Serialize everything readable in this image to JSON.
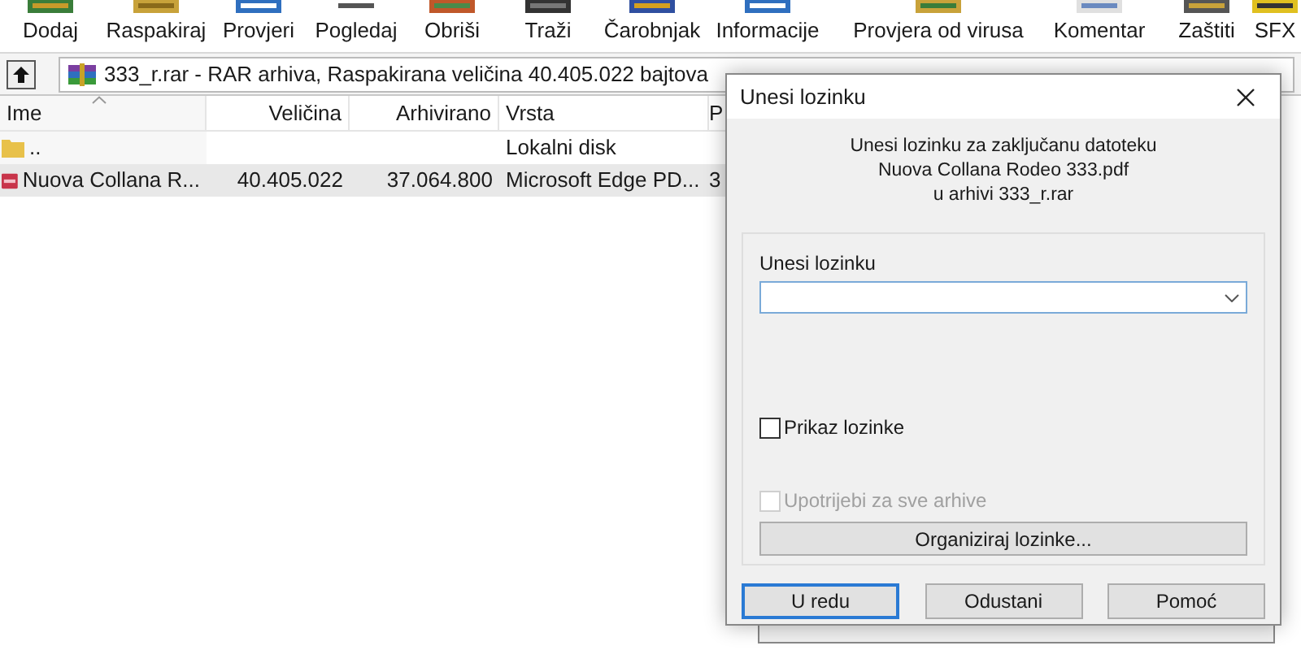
{
  "toolbar": [
    {
      "label": "Dodaj"
    },
    {
      "label": "Raspakiraj"
    },
    {
      "label": "Provjeri"
    },
    {
      "label": "Pogledaj"
    },
    {
      "label": "Obriši"
    },
    {
      "label": "Traži"
    },
    {
      "label": "Čarobnjak"
    },
    {
      "label": "Informacije"
    },
    {
      "label": "Provjera od virusa"
    },
    {
      "label": "Komentar"
    },
    {
      "label": "Zaštiti"
    },
    {
      "label": "SFX"
    }
  ],
  "address_bar": {
    "text": "333_r.rar - RAR arhiva, Raspakirana veličina 40.405.022 bajtova"
  },
  "file_list": {
    "columns": [
      {
        "label": "Ime",
        "sorted": true
      },
      {
        "label": "Veličina",
        "sorted": false
      },
      {
        "label": "Arhivirano",
        "sorted": false
      },
      {
        "label": "Vrsta",
        "sorted": false
      },
      {
        "label": "P"
      }
    ],
    "rows": [
      {
        "kind": "folder",
        "selected": false,
        "cells": [
          "..",
          "",
          "",
          "Lokalni disk",
          ""
        ]
      },
      {
        "kind": "pdf",
        "selected": true,
        "cells": [
          "Nuova Collana R...",
          "40.405.022",
          "37.064.800",
          "Microsoft Edge PD...",
          "3"
        ]
      }
    ]
  },
  "dialog": {
    "title": "Unesi lozinku",
    "message": [
      "Unesi lozinku za zaključanu datoteku",
      "Nuova Collana Rodeo 333.pdf",
      "u arhivi 333_r.rar"
    ],
    "password_label": "Unesi lozinku",
    "checkboxes": [
      {
        "label": "Prikaz lozinke",
        "checked": false,
        "disabled": false
      },
      {
        "label": "Upotrijebi za sve arhive",
        "checked": false,
        "disabled": true
      }
    ],
    "organize_button": "Organiziraj lozinke...",
    "buttons": [
      {
        "label": "U redu",
        "default": true
      },
      {
        "label": "Odustani",
        "default": false
      },
      {
        "label": "Pomoć",
        "default": false
      }
    ]
  }
}
